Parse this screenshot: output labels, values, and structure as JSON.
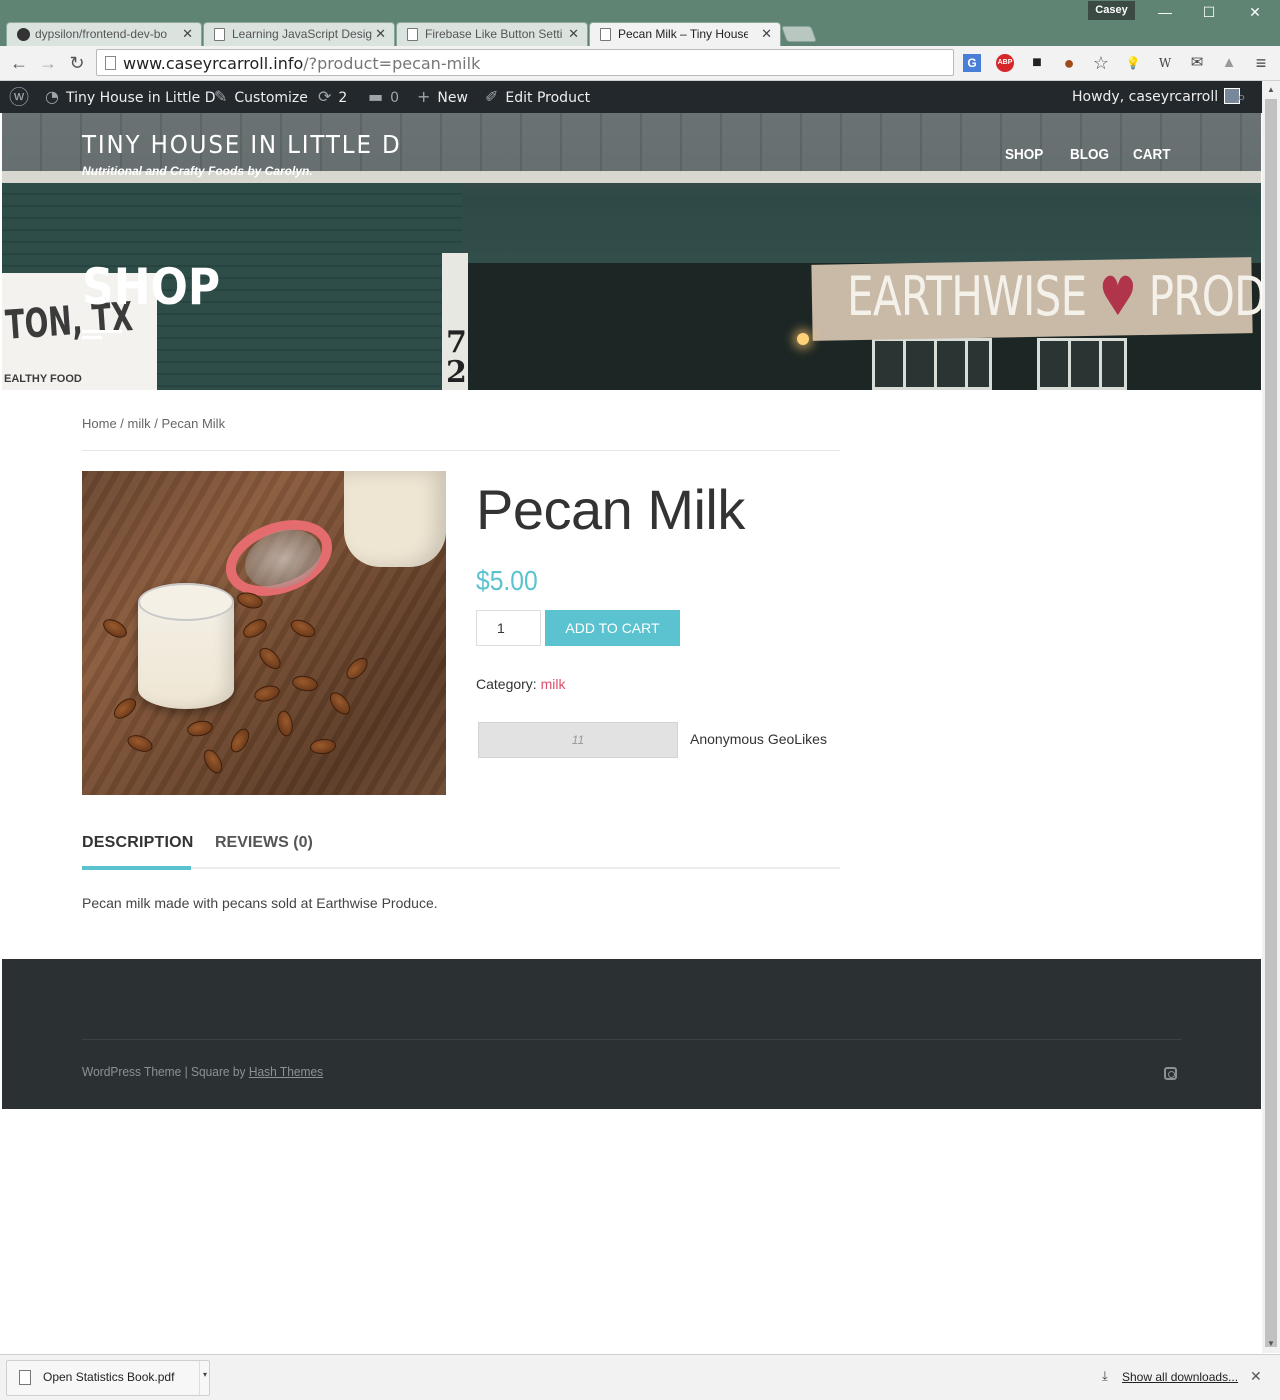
{
  "browser": {
    "profile_name": "Casey",
    "window_controls": {
      "minimize": "—",
      "maximize": "☐",
      "close": "✕"
    },
    "tabs": [
      {
        "label": "dypsilon/frontend-dev-bo",
        "icon": "github-icon",
        "active": false
      },
      {
        "label": "Learning JavaScript Desig",
        "icon": "page-icon",
        "active": false
      },
      {
        "label": "Firebase Like Button Setti",
        "icon": "page-icon",
        "active": false
      },
      {
        "label": "Pecan Milk – Tiny House i",
        "icon": "page-icon",
        "active": true
      }
    ],
    "tab_close": "✕",
    "url_host": "www.caseyrcarroll.info",
    "url_rest": "/?product=pecan-milk",
    "nav": {
      "back": "←",
      "forward": "→",
      "reload": "↻"
    },
    "extensions": [
      "translate-icon",
      "adblock-icon",
      "reader-icon",
      "avatar-icon",
      "star-icon",
      "lightbulb-icon",
      "wikipedia-icon",
      "mail-icon",
      "drive-icon"
    ],
    "extension_glyphs": {
      "translate": "G",
      "adblock": "ABP",
      "reader": "■",
      "avatar": "●",
      "star": "☆",
      "lightbulb": "💡",
      "wikipedia": "W",
      "mail": "✉",
      "drive": "▲"
    },
    "menu": "≡"
  },
  "admin_bar": {
    "site_name": "Tiny House in Little D",
    "customize": "Customize",
    "updates_count": "2",
    "comments_count": "0",
    "new_label": "New",
    "edit_label": "Edit Product",
    "greeting": "Howdy, caseyrcarroll"
  },
  "header": {
    "site_title": "TINY HOUSE IN LITTLE D",
    "tagline": "Nutritional and Crafty Foods by Carolyn.",
    "nav": [
      "SHOP",
      "BLOG",
      "CART"
    ],
    "hero_heading": "SHOP",
    "sign_text_left": "EARTHWISE",
    "sign_text_right": "PRODUCE",
    "sign_beet": "♥",
    "left_sign": "TON, TX",
    "left_sign_small": "EALTHY FOOD",
    "house_number": "7\n2"
  },
  "breadcrumb": {
    "home": "Home",
    "sep": " / ",
    "category": "milk",
    "current": "Pecan Milk"
  },
  "product": {
    "title": "Pecan Milk",
    "price": "$5.00",
    "quantity": "1",
    "add_to_cart": "ADD TO CART",
    "category_label": "Category: ",
    "category": "milk",
    "like_count": "11",
    "like_label": "Anonymous GeoLikes"
  },
  "tabs": {
    "description": "DESCRIPTION",
    "reviews": "REVIEWS (0)",
    "description_text": "Pecan milk made with pecans sold at Earthwise Produce."
  },
  "footer": {
    "credit_prefix": "WordPress Theme | Square by ",
    "credit_link": "Hash Themes"
  },
  "downloads": {
    "file_name": "Open Statistics Book.pdf",
    "show_all": "Show all downloads...",
    "close": "✕"
  },
  "colors": {
    "accent": "#5bc2cf",
    "category_link": "#e04d6b",
    "admin_bar": "#23282d",
    "footer": "#2b3033",
    "chrome_frame": "#5f8474"
  }
}
